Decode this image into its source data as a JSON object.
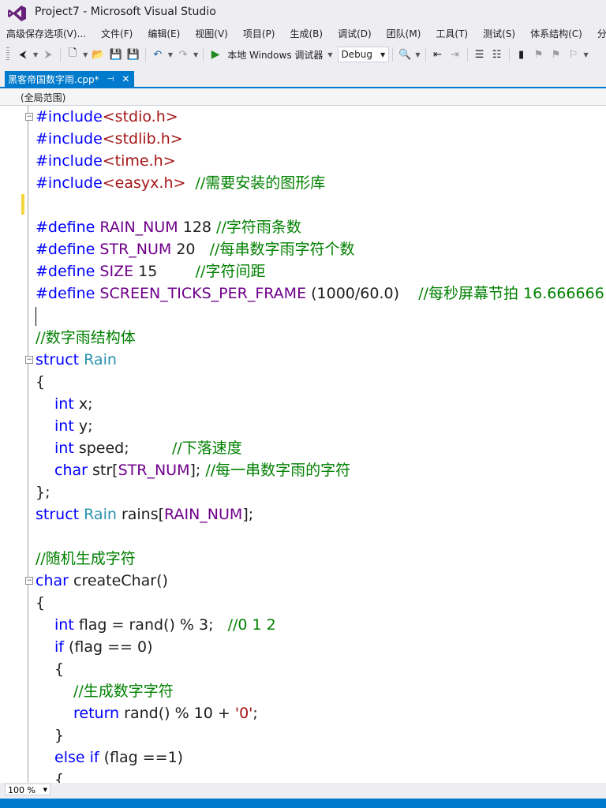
{
  "window": {
    "title": "Project7 - Microsoft Visual Studio"
  },
  "menu": [
    "高级保存选项(V)...",
    "文件(F)",
    "编辑(E)",
    "视图(V)",
    "项目(P)",
    "生成(B)",
    "调试(D)",
    "团队(M)",
    "工具(T)",
    "测试(S)",
    "体系结构(C)",
    "分析("
  ],
  "toolbar": {
    "run_label": "本地 Windows 调试器",
    "config": "Debug"
  },
  "tab": {
    "name": "黑客帝国数字雨.cpp*",
    "pin": "⊣",
    "close": "✕"
  },
  "scope": "(全局范围)",
  "code": {
    "l1": {
      "kw": "#include",
      "hdr": "<stdio.h>"
    },
    "l2": {
      "kw": "#include",
      "hdr": "<stdlib.h>"
    },
    "l3": {
      "kw": "#include",
      "hdr": "<time.h>"
    },
    "l4": {
      "kw": "#include",
      "hdr": "<easyx.h>",
      "cmt": "  //需要安装的图形库"
    },
    "l6": {
      "kw": "#define",
      "name": " RAIN_NUM",
      "val": " 128 ",
      "cmt": "//字符雨条数"
    },
    "l7": {
      "kw": "#define",
      "name": " STR_NUM",
      "val": " 20   ",
      "cmt": "//每串数字雨字符个数"
    },
    "l8": {
      "kw": "#define",
      "name": " SIZE",
      "val": " 15        ",
      "cmt": "//字符间距"
    },
    "l9": {
      "kw": "#define",
      "name": " SCREEN_TICKS_PER_FRAME",
      "val": " (1000/60.0)    ",
      "cmt": "//每秒屏幕节拍 16.666666"
    },
    "l11": {
      "cmt": "//数字雨结构体"
    },
    "l12": {
      "kw": "struct",
      "type": " Rain"
    },
    "l13": {
      "p": "{"
    },
    "l14": {
      "kw": "int",
      "p": " x;"
    },
    "l15": {
      "kw": "int",
      "p": " y;"
    },
    "l16": {
      "kw": "int",
      "p": " speed;         ",
      "cmt": "//下落速度"
    },
    "l17": {
      "kw": "char",
      "p1": " str[",
      "macro": "STR_NUM",
      "p2": "]; ",
      "cmt": "//每一串数字雨的字符"
    },
    "l18": {
      "p": "};"
    },
    "l19": {
      "kw": "struct",
      "type": " Rain",
      "p1": " rains[",
      "macro": "RAIN_NUM",
      "p2": "];"
    },
    "l21": {
      "cmt": "//随机生成字符"
    },
    "l22": {
      "kw": "char",
      "p": " createChar()"
    },
    "l23": {
      "p": "{"
    },
    "l24": {
      "kw": "int",
      "p": " flag = rand() % 3;   ",
      "cmt": "//0 1 2"
    },
    "l25": {
      "kw": "if",
      "p": " (flag == 0)"
    },
    "l26": {
      "p": "{"
    },
    "l27": {
      "cmt": "//生成数字字符"
    },
    "l28": {
      "kw": "return",
      "p": " rand() % 10 + ",
      "str": "'0'",
      "p2": ";"
    },
    "l29": {
      "p": "}"
    },
    "l30": {
      "kw": "else if",
      "p": " (flag ==1)"
    },
    "l31": {
      "p": "{"
    }
  },
  "status": {
    "zoom": "100 %"
  }
}
